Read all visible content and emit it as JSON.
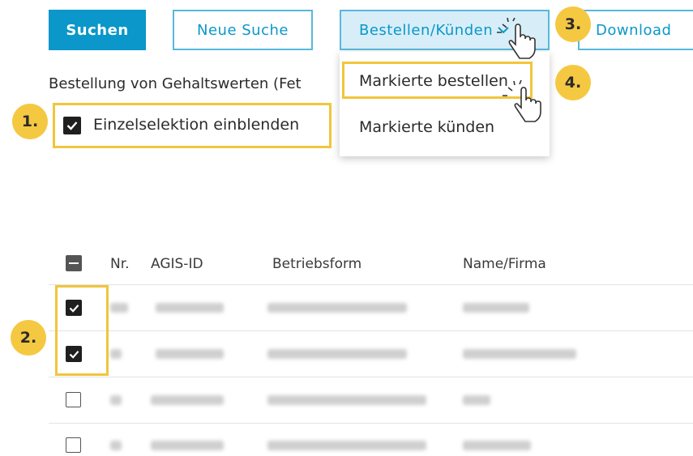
{
  "toolbar": {
    "search_label": "Suchen",
    "new_search_label": "Neue Suche",
    "order_cancel_label": "Bestellen/Künden",
    "download_label": "Download"
  },
  "info_text": "Bestellung von Gehaltswerten (Fet",
  "single_selection": {
    "label": "Einzelselektion einblenden",
    "checked": true
  },
  "dropdown_menu": {
    "items": [
      "Markierte bestellen",
      "Markierte künden"
    ]
  },
  "step_markers": [
    "1.",
    "2.",
    "3.",
    "4."
  ],
  "table": {
    "columns": [
      "Nr.",
      "AGIS-ID",
      "Betriebsform",
      "Name/Firma"
    ],
    "rows": [
      {
        "checked": true
      },
      {
        "checked": true
      },
      {
        "checked": false
      },
      {
        "checked": false
      }
    ]
  },
  "colors": {
    "accent": "#0b97c9",
    "highlight": "#f2c53b",
    "marker": "#f5c842"
  },
  "icons": [
    "chevron-down-icon",
    "hand-pointer-icon",
    "checkmark-icon",
    "minus-icon"
  ]
}
